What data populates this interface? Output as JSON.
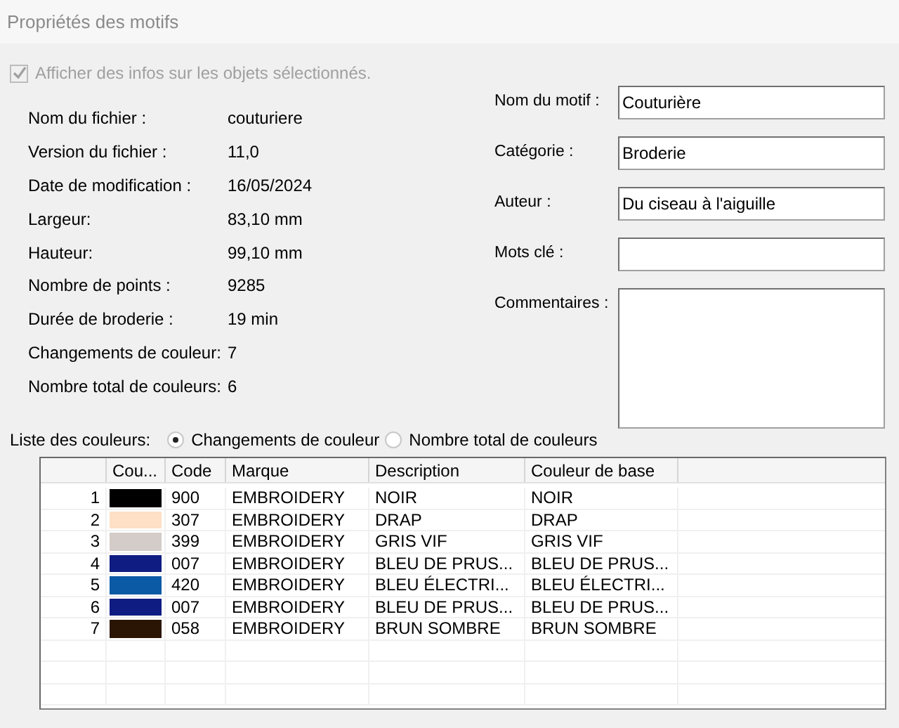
{
  "window": {
    "title": "Propriétés des motifs"
  },
  "show_info": {
    "label": "Afficher des infos sur les objets sélectionnés.",
    "checked": true,
    "disabled": true
  },
  "file_info": [
    {
      "label": "Nom du fichier :",
      "value": "couturiere"
    },
    {
      "label": "Version du fichier :",
      "value": "11,0"
    },
    {
      "label": "Date de modification :",
      "value": "16/05/2024"
    },
    {
      "label": "Largeur:",
      "value": "83,10 mm"
    },
    {
      "label": "Hauteur:",
      "value": "99,10 mm"
    },
    {
      "label": "Nombre de points :",
      "value": "9285"
    },
    {
      "label": "Durée de broderie :",
      "value": "19 min"
    },
    {
      "label": "Changements de couleur:",
      "value": "7"
    },
    {
      "label": "Nombre total de couleurs:",
      "value": "6"
    }
  ],
  "fields": [
    {
      "label": "Nom du motif :",
      "value": "Couturière",
      "kind": "line"
    },
    {
      "label": "Catégorie :",
      "value": "Broderie",
      "kind": "line"
    },
    {
      "label": "Auteur :",
      "value": "Du ciseau à l'aiguille",
      "kind": "line"
    },
    {
      "label": "Mots clé :",
      "kind": "line"
    },
    {
      "label": "Commentaires :",
      "kind": "multiline"
    }
  ],
  "color_list": {
    "label": "Liste des couleurs:",
    "options": [
      {
        "label": "Changements de couleur",
        "selected": true
      },
      {
        "label": "Nombre total de couleurs",
        "selected": false
      }
    ]
  },
  "table": {
    "columns": [
      "Cou...",
      "Code",
      "Marque",
      "Description",
      "Couleur de base"
    ],
    "rows": [
      {
        "index": "1",
        "color": "#000000",
        "code": "900",
        "brand": "EMBROIDERY",
        "description": "NOIR",
        "base": "NOIR"
      },
      {
        "index": "2",
        "color": "#fde0c6",
        "code": "307",
        "brand": "EMBROIDERY",
        "description": "DRAP",
        "base": "DRAP"
      },
      {
        "index": "3",
        "color": "#d3ccc8",
        "code": "399",
        "brand": "EMBROIDERY",
        "description": "GRIS VIF",
        "base": "GRIS VIF"
      },
      {
        "index": "4",
        "color": "#0f1c82",
        "code": "007",
        "brand": "EMBROIDERY",
        "description": "BLEU DE PRUS...",
        "base": "BLEU DE PRUS..."
      },
      {
        "index": "5",
        "color": "#0b5aa5",
        "code": "420",
        "brand": "EMBROIDERY",
        "description": "BLEU ÉLECTRI...",
        "base": "BLEU ÉLECTRI..."
      },
      {
        "index": "6",
        "color": "#0f1c82",
        "code": "007",
        "brand": "EMBROIDERY",
        "description": "BLEU DE PRUS...",
        "base": "BLEU DE PRUS..."
      },
      {
        "index": "7",
        "color": "#2a1505",
        "code": "058",
        "brand": "EMBROIDERY",
        "description": "BRUN SOMBRE",
        "base": "BRUN SOMBRE"
      }
    ]
  }
}
